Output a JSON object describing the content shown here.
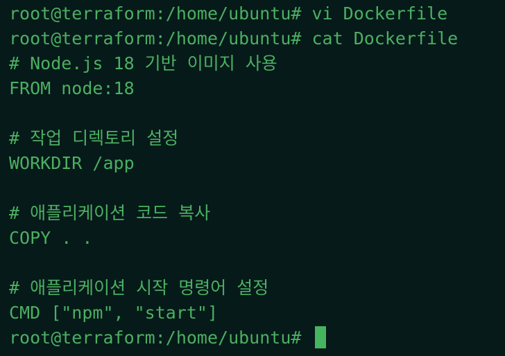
{
  "terminal": {
    "lines": [
      "root@terraform:/home/ubuntu# vi Dockerfile",
      "root@terraform:/home/ubuntu# cat Dockerfile",
      "# Node.js 18 기반 이미지 사용",
      "FROM node:18",
      "",
      "# 작업 디렉토리 설정",
      "WORKDIR /app",
      "",
      "# 애플리케이션 코드 복사",
      "COPY . .",
      "",
      "# 애플리케이션 시작 명령어 설정",
      "CMD [\"npm\", \"start\"]",
      "root@terraform:/home/ubuntu# "
    ],
    "colors": {
      "background": "#061a1a",
      "text": "#4caf61",
      "cursor": "#46b35f"
    }
  }
}
